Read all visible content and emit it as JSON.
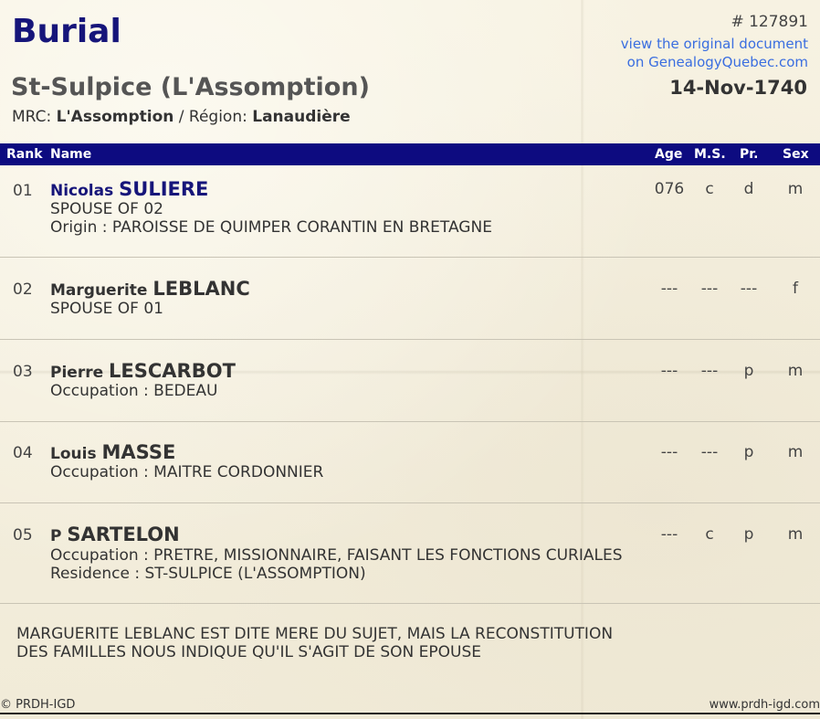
{
  "record": {
    "type": "Burial",
    "parish": "St-Sulpice (L'Assomption)",
    "mrc_label": "MRC:",
    "mrc": "L'Assomption",
    "region_label": "/ Région:",
    "region": "Lanaudière",
    "number": "# 127891",
    "link_line1": "view the original document",
    "link_line2": "on GenealogyQuebec.com",
    "date": "14-Nov-1740"
  },
  "columns": {
    "rank": "Rank",
    "name": "Name",
    "age": "Age",
    "ms": "M.S.",
    "pr": "Pr.",
    "sex": "Sex"
  },
  "persons": [
    {
      "rank": "01",
      "given": "Nicolas",
      "surname": "SULIERE",
      "lines": [
        "SPOUSE  OF 02",
        "Origin : PAROISSE DE QUIMPER CORANTIN EN BRETAGNE"
      ],
      "age": "076",
      "ms": "c",
      "pr": "d",
      "sex": "m"
    },
    {
      "rank": "02",
      "given": "Marguerite",
      "surname": "LEBLANC",
      "lines": [
        "SPOUSE  OF 01"
      ],
      "age": "---",
      "ms": "---",
      "pr": "---",
      "sex": "f"
    },
    {
      "rank": "03",
      "given": "Pierre",
      "surname": "LESCARBOT",
      "lines": [
        "Occupation : BEDEAU"
      ],
      "age": "---",
      "ms": "---",
      "pr": "p",
      "sex": "m"
    },
    {
      "rank": "04",
      "given": "Louis",
      "surname": "MASSE",
      "lines": [
        "Occupation : MAITRE CORDONNIER"
      ],
      "age": "---",
      "ms": "---",
      "pr": "p",
      "sex": "m"
    },
    {
      "rank": "05",
      "given": "P",
      "surname": "SARTELON",
      "lines": [
        "Occupation : PRETRE, MISSIONNAIRE, FAISANT LES FONCTIONS CURIALES",
        "Residence : ST-SULPICE (L'ASSOMPTION)"
      ],
      "age": "---",
      "ms": "c",
      "pr": "p",
      "sex": "m"
    }
  ],
  "note": "MARGUERITE LEBLANC EST DITE MERE DU SUJET, MAIS LA RECONSTITUTION DES FAMILLES NOUS INDIQUE QU'IL S'AGIT DE SON EPOUSE",
  "footer": {
    "copyright": "© PRDH-IGD",
    "site": "www.prdh-igd.com"
  },
  "colors": {
    "header_bg": "#0d0b80",
    "title": "#16157a",
    "link": "#3a6ee0",
    "paper": "#f4eedc"
  }
}
